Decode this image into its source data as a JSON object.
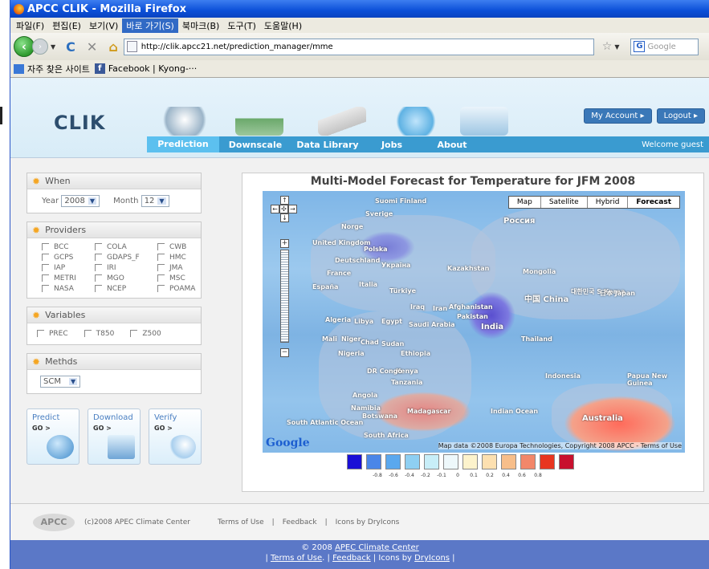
{
  "window": {
    "title": "APCC CLIK - Mozilla Firefox"
  },
  "menu": [
    "파일(F)",
    "편집(E)",
    "보기(V)",
    "바로 가기(S)",
    "북마크(B)",
    "도구(T)",
    "도움말(H)"
  ],
  "browser": {
    "url": "http://clik.apcc21.net/prediction_manager/mme",
    "search_placeholder": "Google"
  },
  "bookmarks": {
    "folder": "자주 찾은 사이트",
    "facebook": "Facebook | Kyong-···"
  },
  "site": {
    "logo": "CLIK",
    "nav": [
      "Prediction",
      "Downscale",
      "Data Library",
      "Jobs",
      "About"
    ],
    "active_nav": "Prediction",
    "my_account": "My Account ▸",
    "logout": "Logout ▸",
    "welcome": "Welcome guest"
  },
  "when": {
    "title": "When",
    "year_label": "Year",
    "year": "2008",
    "month_label": "Month",
    "month": "12"
  },
  "providers": {
    "title": "Providers",
    "items": [
      "BCC",
      "COLA",
      "CWB",
      "GCPS",
      "GDAPS_F",
      "HMC",
      "IAP",
      "IRI",
      "JMA",
      "METRI",
      "MGO",
      "MSC",
      "NASA",
      "NCEP",
      "POAMA"
    ]
  },
  "variables": {
    "title": "Variables",
    "items": [
      "PREC",
      "T850",
      "Z500"
    ]
  },
  "methods": {
    "title": "Methds",
    "value": "SCM"
  },
  "actions": [
    {
      "label": "Predict",
      "go": "GO >"
    },
    {
      "label": "Download",
      "go": "GO >"
    },
    {
      "label": "Verify",
      "go": "GO >"
    }
  ],
  "map": {
    "title": "Multi-Model  Forecast for Temperature for JFM 2008",
    "types": [
      "Map",
      "Satellite",
      "Hybrid",
      "Forecast"
    ],
    "active_type": "Forecast",
    "attribution": "Map data ©2008 Europa Technologies, Copyright 2008 APCC - Terms of Use",
    "google": "Google",
    "labels": [
      "Suomi Finland",
      "Sverige",
      "Norge",
      "United Kingdom",
      "Polska",
      "Deutschland",
      "France",
      "España",
      "Italia",
      "Україна",
      "Kazakhstan",
      "Россия",
      "Mongolia",
      "中国 China",
      "대한민국 S.Korea",
      "日本 Japan",
      "Türkiye",
      "Iraq",
      "Iran",
      "Afghanistan",
      "Pakistan",
      "India",
      "Algeria",
      "Libya",
      "Egypt",
      "Saudi Arabia",
      "Mali",
      "Niger",
      "Chad",
      "Sudan",
      "Nigeria",
      "Ethiopia",
      "Kenya",
      "DR Congo",
      "Tanzania",
      "Angola",
      "Namibia",
      "Botswana",
      "Madagascar",
      "South Africa",
      "Indian Ocean",
      "South Atlantic Ocean",
      "Indonesia",
      "Papua New Guinea",
      "Australia",
      "Thailand"
    ]
  },
  "legend": {
    "colors": [
      "#1a0fd6",
      "#4a86e8",
      "#5aa8ee",
      "#8ecff2",
      "#c8eef8",
      "#eef8fb",
      "#fdf3cc",
      "#fde0b0",
      "#f7be8a",
      "#f2876a",
      "#e8351f",
      "#c8102e"
    ],
    "ticks": [
      "-0.8",
      "-0.6",
      "-0.4",
      "-0.2",
      "-0.1",
      "0",
      "0.1",
      "0.2",
      "0.4",
      "0.6",
      "0.8"
    ]
  },
  "footer": {
    "logo": "APCC",
    "copy": "(c)2008  APEC  Climate  Center",
    "terms": "Terms of Use",
    "sep": "|",
    "feedback": "Feedback",
    "icons": "Icons by DryIcons"
  },
  "bottom": {
    "line1_prefix": "© 2008 ",
    "center": "APEC Climate Center",
    "terms": "Terms of Use",
    "feedback": "Feedback",
    "icons_prefix": " | Icons by ",
    "dryicons": "DryIcons",
    "sep": " | "
  }
}
